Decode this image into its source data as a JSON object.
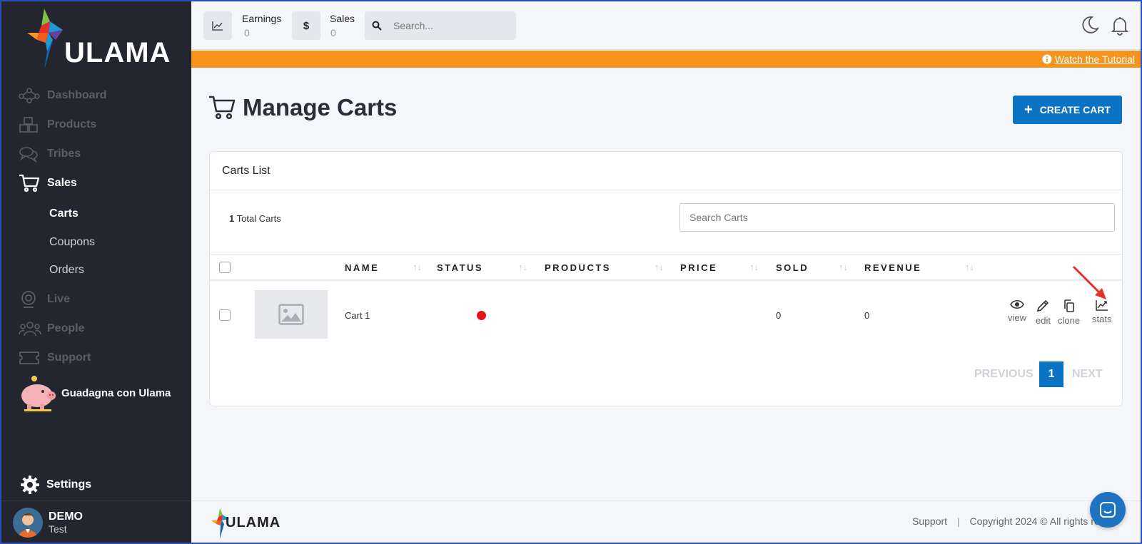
{
  "brand": {
    "logo_text": "ULAMA"
  },
  "sidebar": {
    "items": [
      {
        "label": "Dashboard",
        "icon": "dashboard-icon"
      },
      {
        "label": "Products",
        "icon": "cubes-icon"
      },
      {
        "label": "Tribes",
        "icon": "chat-bubbles-icon"
      },
      {
        "label": "Sales",
        "icon": "cart-icon"
      },
      {
        "label": "Live",
        "icon": "webcam-icon"
      },
      {
        "label": "People",
        "icon": "people-icon"
      },
      {
        "label": "Support",
        "icon": "ticket-icon"
      }
    ],
    "sub_items": [
      {
        "label": "Carts"
      },
      {
        "label": "Coupons"
      },
      {
        "label": "Orders"
      }
    ],
    "promo_label": "Guadagna con Ulama",
    "settings_label": "Settings",
    "user": {
      "name": "DEMO",
      "subtitle": "Test"
    }
  },
  "topbar": {
    "earnings_label": "Earnings",
    "earnings_value": "0",
    "sales_label": "Sales",
    "sales_value": "0",
    "search_placeholder": "Search..."
  },
  "banner": {
    "link_label": "Watch the Tutorial"
  },
  "page": {
    "title": "Manage Carts",
    "create_label": "CREATE CART"
  },
  "card": {
    "title": "Carts List",
    "total_count": "1",
    "total_label": "Total Carts",
    "search_placeholder": "Search Carts",
    "columns": [
      "NAME",
      "STATUS",
      "PRODUCTS",
      "PRICE",
      "SOLD",
      "REVENUE"
    ],
    "rows": [
      {
        "name": "Cart 1",
        "status_color": "#e3161b",
        "sold": "0",
        "revenue": "0"
      }
    ],
    "actions": [
      "view",
      "edit",
      "clone",
      "stats"
    ],
    "pager": {
      "previous": "PREVIOUS",
      "current": "1",
      "next": "NEXT"
    }
  },
  "footer": {
    "support_label": "Support",
    "separator": "|",
    "copyright": "Copyright 2024 © All rights res"
  },
  "colors": {
    "accent": "#0b73c4",
    "banner": "#f7941d",
    "sidebar_bg": "#23252f"
  }
}
